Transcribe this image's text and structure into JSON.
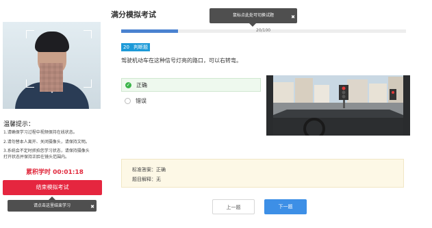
{
  "exam": {
    "title": "满分模拟考试",
    "progress_text": "20/100",
    "progress_fraction": 0.2,
    "question_number": "20",
    "question_type": "判断题",
    "question_text": "驾驶机动车在这种信号灯亮的路口，可以右转弯。",
    "options": [
      {
        "label": "正确",
        "selected": true
      },
      {
        "label": "错误",
        "selected": false
      }
    ],
    "answer_label": "标准答案：正确",
    "explanation_label": "题目解释：无",
    "prev_label": "上一题",
    "next_label": "下一题"
  },
  "sidebar": {
    "tips_title": "温馨提示：",
    "tips": [
      "1.请确保学习过程中视频保持在线状态。",
      "2.请勿替本人离开、关闭摄像头，请保持文明。",
      "3.系统会不定时抓拍您学习状态，请保持摄像头",
      "打开状态并保持正脸在镜头范围内。"
    ],
    "timer_label": "累积学时 00:01:18",
    "end_button_label": "结束模拟考试"
  },
  "tooltips": {
    "top": "鼠标点此处可切换试题",
    "bottom": "请点击这里结束学习"
  },
  "colors": {
    "accent": "#3d8fe6",
    "danger": "#e5263f",
    "badge": "#1d9ad8",
    "correct": "#3bb54a"
  }
}
